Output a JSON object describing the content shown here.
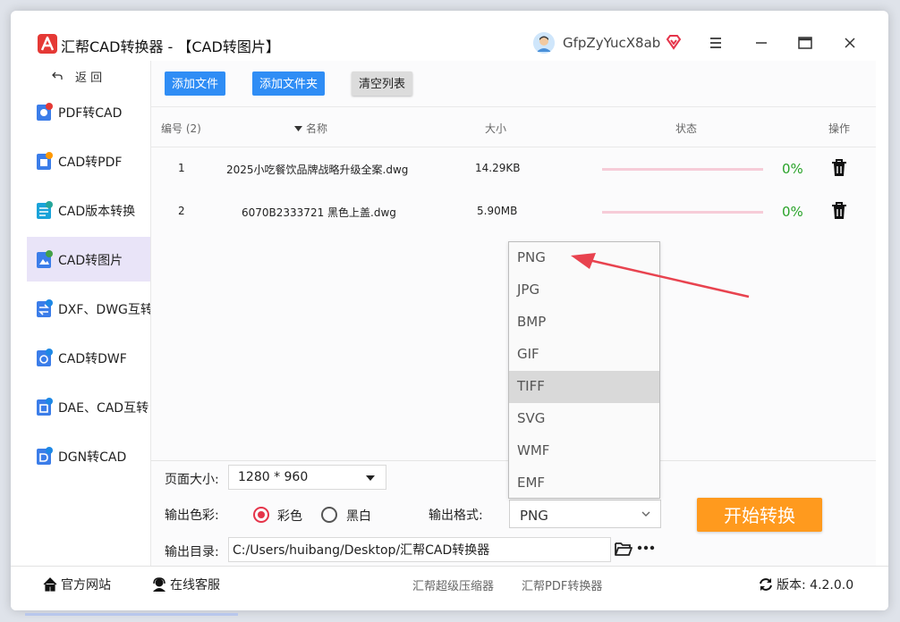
{
  "window": {
    "title": "汇帮CAD转换器 - 【CAD转图片】",
    "username": "GfpZyYucX8ab",
    "brand_color": "#e5344a",
    "accent_color": "#2f8df5"
  },
  "sidebar": {
    "back_label": "返 回",
    "items": [
      {
        "label": "PDF转CAD",
        "icon": "pdf-to-cad-icon"
      },
      {
        "label": "CAD转PDF",
        "icon": "cad-to-pdf-icon"
      },
      {
        "label": "CAD版本转换",
        "icon": "cad-version-icon"
      },
      {
        "label": "CAD转图片",
        "icon": "cad-to-image-icon",
        "active": true
      },
      {
        "label": "DXF、DWG互转",
        "icon": "dxf-dwg-icon"
      },
      {
        "label": "CAD转DWF",
        "icon": "cad-to-dwf-icon"
      },
      {
        "label": "DAE、CAD互转",
        "icon": "dae-cad-icon"
      },
      {
        "label": "DGN转CAD",
        "icon": "dgn-to-cad-icon"
      }
    ]
  },
  "toolbar": {
    "add_file": "添加文件",
    "add_folder": "添加文件夹",
    "clear_list": "清空列表"
  },
  "table": {
    "headers": {
      "index": "编号 (2)",
      "name": "名称",
      "size": "大小",
      "status": "状态",
      "action": "操作"
    },
    "rows": [
      {
        "index": "1",
        "name": "2025小吃餐饮品牌战略升级全案.dwg",
        "size": "14.29KB",
        "progress": 0,
        "percent": "0%"
      },
      {
        "index": "2",
        "name": "6070B2333721 黑色上盖.dwg",
        "size": "5.90MB",
        "progress": 0,
        "percent": "0%"
      }
    ]
  },
  "settings": {
    "page_size_label": "页面大小:",
    "page_size_value": "1280 * 960",
    "color_label": "输出色彩:",
    "color_option_color": "彩色",
    "color_option_bw": "黑白",
    "color_selected": "彩色",
    "format_label": "输出格式:",
    "format_value": "PNG",
    "format_options": [
      "PNG",
      "JPG",
      "BMP",
      "GIF",
      "TIFF",
      "SVG",
      "WMF",
      "EMF"
    ],
    "format_highlighted": "TIFF",
    "dir_label": "输出目录:",
    "dir_value": "C:/Users/huibang/Desktop/汇帮CAD转换器",
    "start_button": "开始转换"
  },
  "footer": {
    "website": "官方网站",
    "support": "在线客服",
    "link_compressor": "汇帮超级压缩器",
    "link_pdf": "汇帮PDF转换器",
    "version": "版本: 4.2.0.0"
  }
}
